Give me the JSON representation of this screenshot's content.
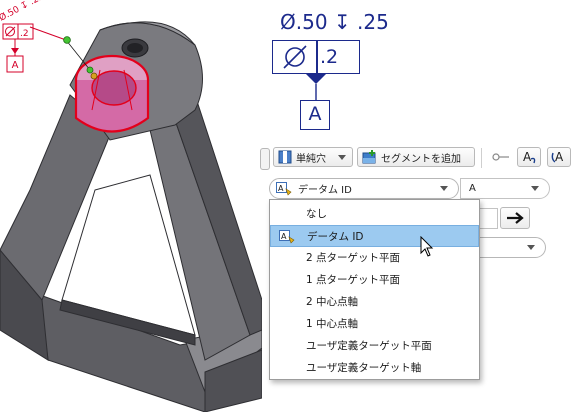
{
  "annotation": {
    "hole_callout": "Ø.50 ↧ .25",
    "tolerance_value": ".2",
    "datum_label": "A"
  },
  "small_annotation": {
    "hole_callout": "Ø.50 ↧ .25",
    "tolerance_value": ".2",
    "datum_label": "A"
  },
  "toolbar": {
    "hole_type_label": "単純穴",
    "add_segment_label": "セグメントを追加"
  },
  "datum_row": {
    "datum_id_label": "データム ID",
    "datum_letter": "A"
  },
  "dropdown": {
    "items": [
      {
        "label": "なし"
      },
      {
        "label": "データム ID"
      },
      {
        "label": "2 点ターゲット平面"
      },
      {
        "label": "1 点ターゲット平面"
      },
      {
        "label": "2 中心点軸"
      },
      {
        "label": "1 中心点軸"
      },
      {
        "label": "ユーザ定義ターゲット平面"
      },
      {
        "label": "ユーザ定義ターゲット軸"
      }
    ],
    "selected_index": 1
  },
  "colors": {
    "annotation_blue": "#1c2a8c",
    "highlight_red": "#e3001b",
    "selection_blue": "#9ccaf0",
    "part_gray": "#6e6e72"
  },
  "icons": {
    "hole_type": "simple-hole-icon",
    "add_segment": "add-segment-icon",
    "pointer_tool": "pointer-tool-icon",
    "text_style_a": "text-style-a-icon",
    "text_style_b": "text-style-b-icon",
    "datum_id": "datum-id-icon",
    "arrow": "arrow-right-icon"
  }
}
